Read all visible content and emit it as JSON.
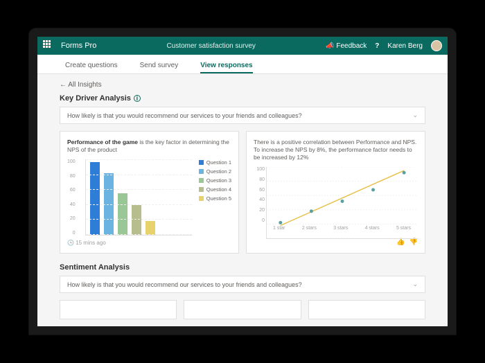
{
  "header": {
    "app_name": "Forms Pro",
    "doc_title": "Customer satisfaction survey",
    "feedback_label": "Feedback",
    "user_name": "Karen Berg"
  },
  "tabs": {
    "create": "Create questions",
    "send": "Send survey",
    "view": "View responses"
  },
  "back_link": "All Insights",
  "sections": {
    "key_driver_title": "Key Driver Analysis",
    "sentiment_title": "Sentiment Analysis",
    "question_text": "How likely is that you would recommend our services to your friends and colleagues?"
  },
  "card_bar": {
    "text_prefix": "Performance of the game",
    "text_rest": " is the key factor in determining the NPS of the product",
    "timestamp": "15 mins ago",
    "legend": [
      "Question 1",
      "Question 2",
      "Question 3",
      "Question 4",
      "Question 5"
    ]
  },
  "card_line": {
    "text": "There is a positive correlation between Performance and NPS. To increase the NPS by 8%, the performance factor needs to be increased by 12%"
  },
  "chart_data": [
    {
      "type": "bar",
      "categories": [
        "Question 1",
        "Question 2",
        "Question 3",
        "Question 4",
        "Question 5"
      ],
      "values": [
        96,
        82,
        55,
        40,
        18
      ],
      "colors": [
        "#2e7dd6",
        "#6bb3e0",
        "#9ac796",
        "#b8bd8e",
        "#e8d26b"
      ],
      "ylim": [
        0,
        100
      ],
      "yticks": [
        0,
        20,
        40,
        60,
        80,
        100
      ],
      "title": "Performance of the game is the key factor in determining the NPS of the product"
    },
    {
      "type": "scatter-line",
      "x_labels": [
        "1 star",
        "2 stars",
        "3 stars",
        "4 stars",
        "5 stars"
      ],
      "points": [
        22,
        38,
        52,
        68,
        92
      ],
      "line_fit": {
        "start": 18,
        "end": 95
      },
      "ylim": [
        0,
        100
      ],
      "yticks": [
        0,
        20,
        40,
        60,
        80,
        100
      ],
      "point_color": "#5aa0a0",
      "line_color": "#e6c14a"
    }
  ]
}
